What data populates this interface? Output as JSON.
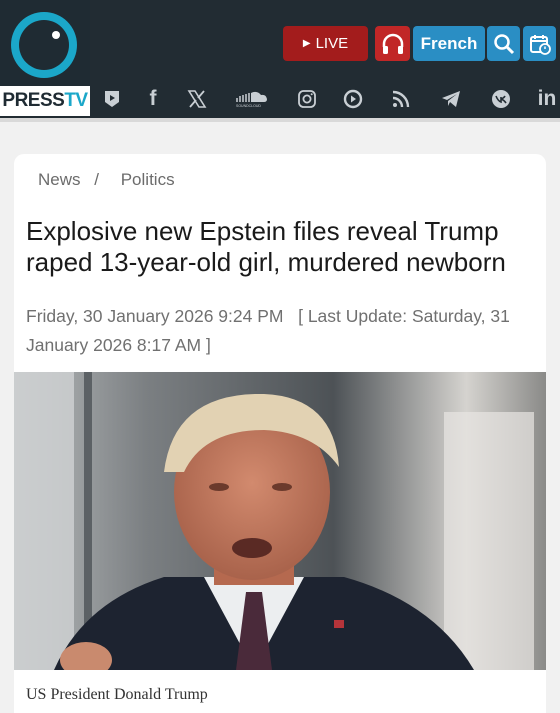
{
  "brand": {
    "logo_text_a": "PRESS",
    "logo_text_b": "TV"
  },
  "header": {
    "live_label": "LIVE",
    "language_label": "French"
  },
  "social": [
    "youtube-icon",
    "facebook-icon",
    "x-icon",
    "soundcloud-icon",
    "instagram-icon",
    "rumble-icon",
    "rss-icon",
    "telegram-icon",
    "vk-icon",
    "linkedin-icon"
  ],
  "colors": {
    "accent_blue": "#2a8ec4",
    "live_red": "#a31c1c",
    "brand_cyan": "#1ba7c9",
    "header_dark": "#222c33"
  },
  "article": {
    "breadcrumb": {
      "section": "News",
      "separator": "/",
      "category": "Politics"
    },
    "title": "Explosive new Epstein files reveal Trump raped 13-year-old girl, murdered newborn",
    "published": "Friday, 30 January 2026 9:24 PM",
    "updated_prefix": "[ Last Update:",
    "updated": "Saturday, 31 January 2026 8:17 AM",
    "updated_suffix": "]",
    "image_caption": "US President Donald Trump"
  }
}
